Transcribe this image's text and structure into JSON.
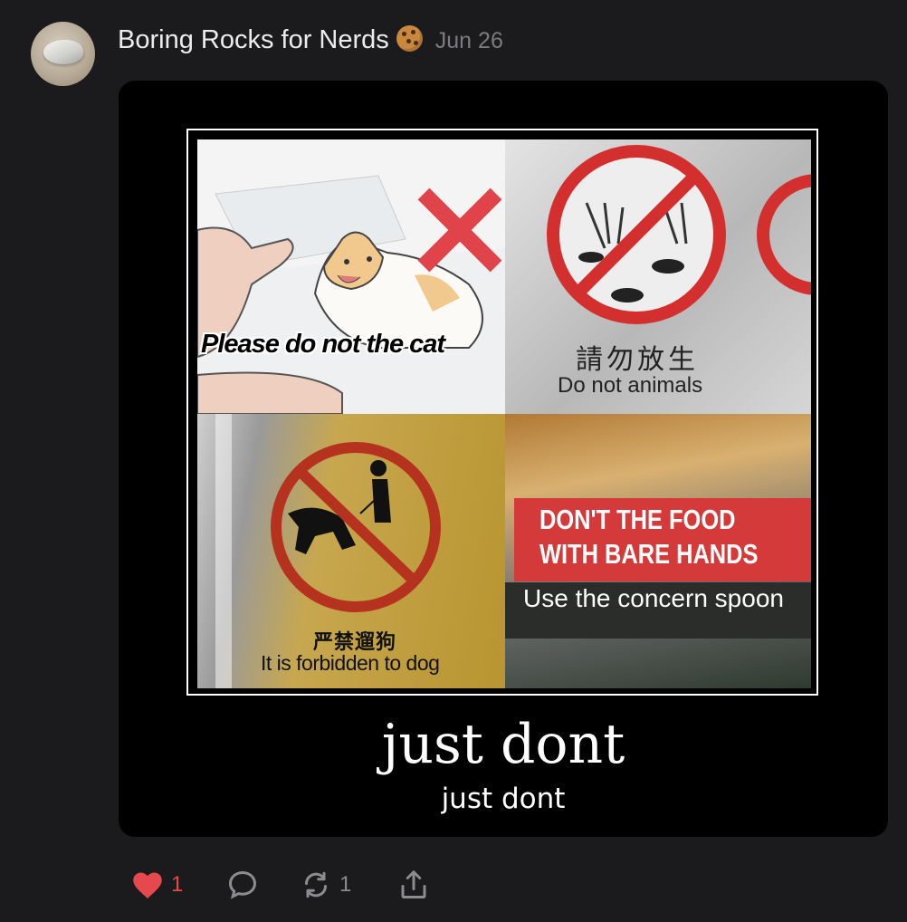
{
  "post": {
    "author": "Boring Rocks for Nerds",
    "date": "Jun 26",
    "badge_icon": "cookie-icon"
  },
  "meme": {
    "panels": [
      {
        "caption": "Please do not the cat"
      },
      {
        "caption_zh": "請勿放生",
        "caption": "Do not animals"
      },
      {
        "caption_zh": "严禁遛狗",
        "caption": "It is forbidden to dog"
      },
      {
        "sign_line1": "DON'T THE FOOD",
        "sign_line2": "WITH BARE HANDS",
        "caption": "Use the concern spoon"
      }
    ],
    "title": "just dont",
    "subtitle": "just dont"
  },
  "actions": {
    "like_count": "1",
    "repost_count": "1",
    "like_color": "#e5484d",
    "icon_color": "#8b8b90"
  }
}
